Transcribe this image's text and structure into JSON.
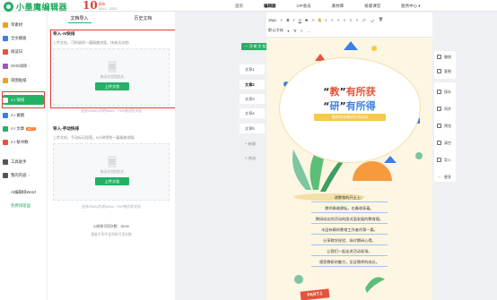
{
  "app": {
    "logo_text": "小墨鹰编辑器",
    "anniversary_number": "10",
    "anniversary_label": "周年",
    "anniversary_years": "2011 - 2021"
  },
  "topnav": {
    "items": [
      {
        "label": "首页",
        "active": false
      },
      {
        "label": "编辑器",
        "active": true
      },
      {
        "label": "VIP会员",
        "active": false
      },
      {
        "label": "素材库",
        "active": false
      },
      {
        "label": "排版课堂",
        "active": false
      }
    ],
    "user_center": "服务中心"
  },
  "sidebar": {
    "items": [
      {
        "label": "单素材",
        "color": "#f0a020"
      },
      {
        "label": "全文模板",
        "color": "#3c7fe0"
      },
      {
        "label": "阅读日",
        "color": "#e5533c"
      },
      {
        "label": "SVG动效",
        "color": "#9b59b6"
      },
      {
        "label": "简图贴纸",
        "color": "#f0a020"
      },
      {
        "label": "A I 快排",
        "color": "#ffffff"
      },
      {
        "label": "A I 做图",
        "color": "#3c7fe0"
      },
      {
        "label": "A I 文章",
        "color": "#23b165"
      },
      {
        "label": "A I 秘书数",
        "color": "#e5533c"
      },
      {
        "label": "工具助手",
        "color": "#555555"
      },
      {
        "label": "我的内容",
        "color": "#555555"
      }
    ],
    "hot_badge": "HOT",
    "footer_link_1": "AI编辑排Word",
    "footer_link_2": "免费排版面"
  },
  "import_panel": {
    "tabs": [
      "文档导入",
      "历史文档"
    ],
    "section_ai": {
      "title": "导入-AI快排",
      "desc": "上传文档，可秒级到一篇精美排版，快来试试吧!",
      "drop_hint": "拖动文档到此处",
      "button": "上传文档",
      "note": "支持200M以内的Word、PDF格式的文档"
    },
    "section_manual": {
      "title": "导入-手动快排",
      "desc": "上传文档，手动标记段落，5分钟得到一篇精美排版!",
      "drop_hint": "拖动文档到此处",
      "button": "上传文档",
      "note": "支持20M以内的Word、PDF格式的文档",
      "quota": "AI快排可用次数：28/30",
      "quota_note": "重复不同不会消耗可用次数"
    }
  },
  "doc_list": {
    "tag": "一 开 新 文 档",
    "items": [
      "文章1",
      "文章2",
      "文章3",
      "文章4",
      "文章5"
    ],
    "new_label": "+ 新建",
    "close_label": "× 关闭"
  },
  "editor": {
    "toolbar_row1": [
      "16px",
      "≡",
      "B",
      "I",
      "U",
      "S",
      "A",
      "A",
      "≡",
      "≡",
      "≡",
      "≡",
      "≡",
      "≡",
      "⤺",
      "⤻",
      "🗑"
    ],
    "toolbar_row2": [
      "默认字体",
      "▾",
      "Tr",
      "≡",
      "…"
    ],
    "headline_line1": {
      "q_open": "“",
      "word": "教",
      "q_close": "”",
      "rest": "有所获"
    },
    "headline_line2": {
      "q_open": "“",
      "word": "研",
      "q_close": "”",
      "rest": "有所得"
    },
    "subtitle": "教师成长教研交流活动",
    "poem": [
      "改教育的开土上，",
      "教师勇敢耕耘，也春收获着。",
      "教研成长的活动的面对面发展的教育理。",
      "丰田有精的教育工作者作第一篇。",
      "分享教学经验、探讨教研心得。",
      "让我们一起走进活动现场，",
      "感受教研的魅力，见证教师的成长。"
    ],
    "part_badge": "PART.1"
  },
  "rail": {
    "card1": [
      "撤销",
      "复制"
    ],
    "card2": [
      "保存",
      "同步",
      "预览",
      "清空",
      "导入",
      "更多"
    ]
  },
  "colors": {
    "brand_green": "#23b165",
    "highlight_red": "#e53935",
    "page_bg": "#fdf6e3"
  }
}
